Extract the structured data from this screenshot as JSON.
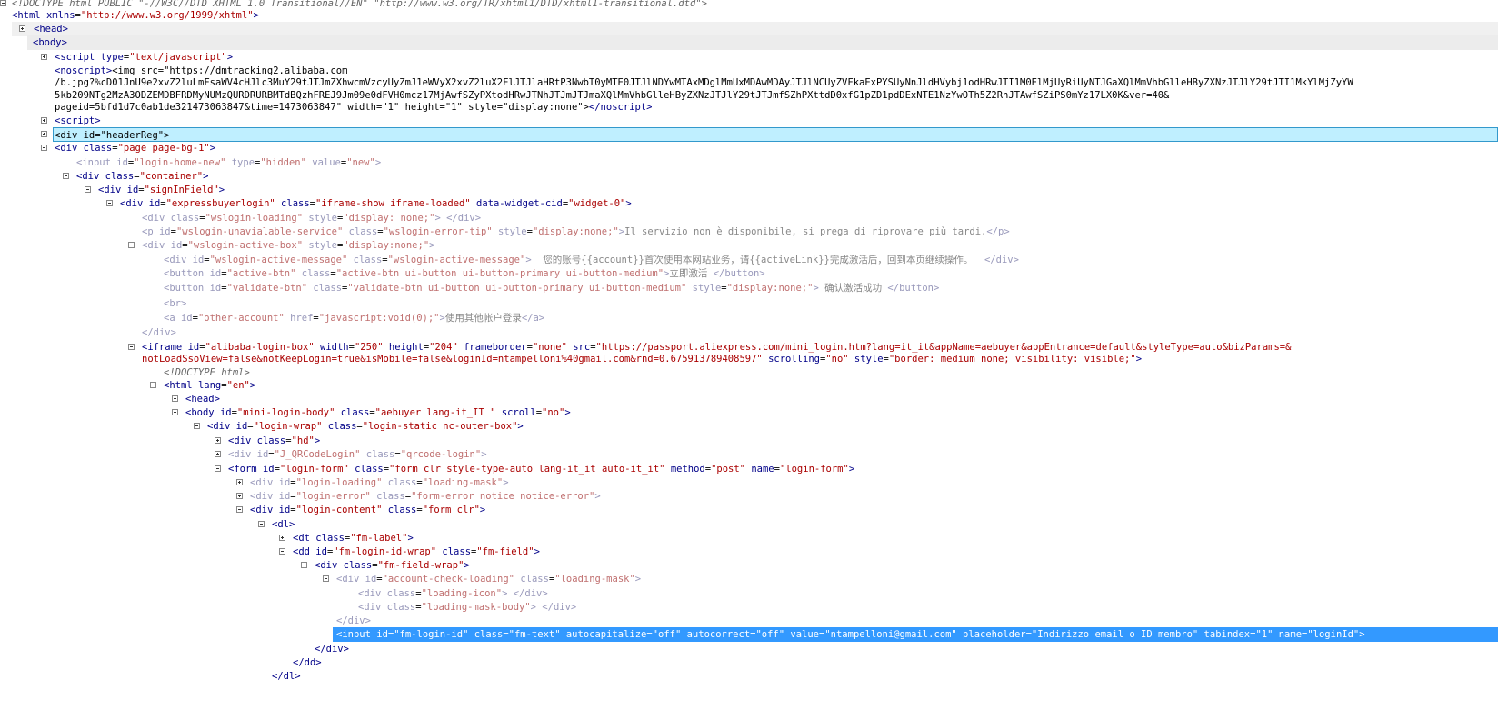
{
  "tree": {
    "doctype": "<!DOCTYPE html PUBLIC \"-//W3C//DTD XHTML 1.0 Transitional//EN\" \"http://www.w3.org/TR/xhtml1/DTD/xhtml1-transitional.dtd\">",
    "html_open_tag": "<html",
    "html_attr": "xmlns",
    "html_attr_val": "\"http://www.w3.org/1999/xhtml\"",
    "head": "<head>",
    "body": "<body>",
    "script1_tag": "<script",
    "script1_attr": "type",
    "script1_val": "\"text/javascript\"",
    "noscript_open": "<noscript>",
    "noscript_img": "<img src=\"https://dmtracking2.alibaba.com",
    "noscript_line2": "/b.jpg?%cD01JnU9e2xvZ2luLmFsaWV4cHJlc3MuY29tJTJmZXhwcmVzcyUyZmJ1eWVyX2xvZ2luX2FlJTJlaHRtP3NwbT0yMTE0JTJlNDYwMTAxMDglMmUxMDAwMDAyJTJlNCUyZVFkaExPYSUyNnJldHVybj1odHRwJTI1M0ElMjUyRiUyNTJGaXQlMmVhbGlleHByZXNzJTJlY29tJTI1MkYlMjZyYW",
    "noscript_line3": "5kb209NTg2MzA3ODZEMDBFRDMyNUMzQURDRURBMTdBQzhFREJ9Jm09e0dFVH0mcz17MjAwfSZyPXtodHRwJTNhJTJmJTJmaXQlMmVhbGlleHByZXNzJTJlY29tJTJmfSZhPXttdD0xfG1pZD1pdDExNTE1NzYwOTh5Z2RhJTAwfSZiPS0mYz17LX0K&ver=40&",
    "noscript_line4_a": "pageid=5bfd1d7c0ab1de321473063847&time=1473063847\" width=\"1\" height=\"1\" style=\"display:none\">",
    "noscript_close": "</noscript>",
    "script2": "<script>",
    "header_reg": "<div id=\"headerReg\">",
    "div_page_tag": "<div",
    "div_page_attr": "class",
    "div_page_val": "\"page page-bg-1\"",
    "input_hidden": {
      "tag": "<input",
      "a1": "id",
      "v1": "\"login-home-new\"",
      "a2": "type",
      "v2": "\"hidden\"",
      "a3": "value",
      "v3": "\"new\""
    },
    "container": {
      "tag": "<div",
      "a": "class",
      "v": "\"container\""
    },
    "signin": {
      "tag": "<div",
      "a": "id",
      "v": "\"signInField\""
    },
    "expressbuyer": {
      "tag": "<div",
      "a1": "id",
      "v1": "\"expressbuyerlogin\"",
      "a2": "class",
      "v2": "\"iframe-show iframe-loaded\"",
      "a3": "data-widget-cid",
      "v3": "\"widget-0\""
    },
    "wslogin_loading": {
      "tag": "<div",
      "a1": "class",
      "v1": "\"wslogin-loading\"",
      "a2": "style",
      "v2": "\"display: none;\"",
      "close": "</div>"
    },
    "wslogin_unavailable": {
      "tag": "<p",
      "a1": "id",
      "v1": "\"wslogin-unavialable-service\"",
      "a2": "class",
      "v2": "\"wslogin-error-tip\"",
      "a3": "style",
      "v3": "\"display:none;\"",
      "text": "Il servizio non è disponibile, si prega di riprovare più tardi.",
      "close": "</p>"
    },
    "wslogin_active_box": {
      "tag": "<div",
      "a1": "id",
      "v1": "\"wslogin-active-box\"",
      "a2": "style",
      "v2": "\"display:none;\""
    },
    "active_message": {
      "tag": "<div",
      "a1": "id",
      "v1": "\"wslogin-active-message\"",
      "a2": "class",
      "v2": "\"wslogin-active-message\"",
      "text1": "您的账号",
      "acc": "{{account}}",
      "text2": "首次使用本网站业务，请",
      "link": "{{activeLink}}",
      "text3": "完成激活后，回到本页继续操作。",
      "close": "</div>"
    },
    "active_btn": {
      "tag": "<button",
      "a1": "id",
      "v1": "\"active-btn\"",
      "a2": "class",
      "v2": "\"active-btn ui-button ui-button-primary ui-button-medium\"",
      "text": "立即激活",
      "close": "</button>"
    },
    "validate_btn": {
      "tag": "<button",
      "a1": "id",
      "v1": "\"validate-btn\"",
      "a2": "class",
      "v2": "\"validate-btn ui-button ui-button-primary ui-button-medium\"",
      "a3": "style",
      "v3": "\"display:none;\"",
      "text": "确认激活成功",
      "close": "</button>"
    },
    "br": "<br>",
    "other_account": {
      "tag": "<a",
      "a1": "id",
      "v1": "\"other-account\"",
      "a2": "href",
      "v2": "\"javascript:void(0);\"",
      "text": "使用其他帐户登录",
      "close": "</a>"
    },
    "div_close": "</div>",
    "iframe": {
      "tag": "<iframe",
      "a1": "id",
      "v1": "\"alibaba-login-box\"",
      "a2": "width",
      "v2": "\"250\"",
      "a3": "height",
      "v3": "\"204\"",
      "a4": "frameborder",
      "v4": "\"none\"",
      "a5": "src",
      "v5": "\"https://passport.aliexpress.com/mini_login.htm?lang=it_it&appName=aebuyer&appEntrance=default&styleType=auto&bizParams=&",
      "line2_v": "notLoadSsoView=false&notKeepLogin=true&isMobile=false&loginId=ntampelloni%40gmail.com&rnd=0.675913789408597\"",
      "a6": "scrolling",
      "v6": "\"no\"",
      "a7": "style",
      "v7": "\"border: medium none; visibility: visible;\""
    },
    "inner_doctype": "<!DOCTYPE html>",
    "inner_html": {
      "tag": "<html",
      "a": "lang",
      "v": "\"en\""
    },
    "inner_head": "<head>",
    "inner_body": {
      "tag": "<body",
      "a1": "id",
      "v1": "\"mini-login-body\"",
      "a2": "class",
      "v2": "\"aebuyer lang-it_IT \"",
      "a3": "scroll",
      "v3": "\"no\""
    },
    "login_wrap": {
      "tag": "<div",
      "a1": "id",
      "v1": "\"login-wrap\"",
      "a2": "class",
      "v2": "\"login-static nc-outer-box\""
    },
    "hd": {
      "tag": "<div",
      "a": "class",
      "v": "\"hd\""
    },
    "qrcode": {
      "tag": "<div",
      "a1": "id",
      "v1": "\"J_QRCodeLogin\"",
      "a2": "class",
      "v2": "\"qrcode-login\""
    },
    "form": {
      "tag": "<form",
      "a1": "id",
      "v1": "\"login-form\"",
      "a2": "class",
      "v2": "\"form clr style-type-auto lang-it_it auto-it_it\"",
      "a3": "method",
      "v3": "\"post\"",
      "a4": "name",
      "v4": "\"login-form\""
    },
    "login_loading": {
      "tag": "<div",
      "a1": "id",
      "v1": "\"login-loading\"",
      "a2": "class",
      "v2": "\"loading-mask\""
    },
    "login_error": {
      "tag": "<div",
      "a1": "id",
      "v1": "\"login-error\"",
      "a2": "class",
      "v2": "\"form-error notice notice-error\""
    },
    "login_content": {
      "tag": "<div",
      "a1": "id",
      "v1": "\"login-content\"",
      "a2": "class",
      "v2": "\"form clr\""
    },
    "dl": "<dl>",
    "dt": {
      "tag": "<dt",
      "a": "class",
      "v": "\"fm-label\""
    },
    "dd": {
      "tag": "<dd",
      "a1": "id",
      "v1": "\"fm-login-id-wrap\"",
      "a2": "class",
      "v2": "\"fm-field\""
    },
    "field_wrap": {
      "tag": "<div",
      "a": "class",
      "v": "\"fm-field-wrap\""
    },
    "account_check": {
      "tag": "<div",
      "a1": "id",
      "v1": "\"account-check-loading\"",
      "a2": "class",
      "v2": "\"loading-mask\""
    },
    "loading_icon": {
      "tag": "<div",
      "a": "class",
      "v": "\"loading-icon\"",
      "close": "</div>"
    },
    "loading_body": {
      "tag": "<div",
      "a": "class",
      "v": "\"loading-mask-body\"",
      "close": "</div>"
    },
    "selected_input": "<input id=\"fm-login-id\" class=\"fm-text\" autocapitalize=\"off\" autocorrect=\"off\" value=\"ntampelloni@gmail.com\" placeholder=\"Indirizzo email o ID membro\" tabindex=\"1\" name=\"loginId\">",
    "dd_close": "</dd>",
    "dl_close": "</dl>"
  }
}
